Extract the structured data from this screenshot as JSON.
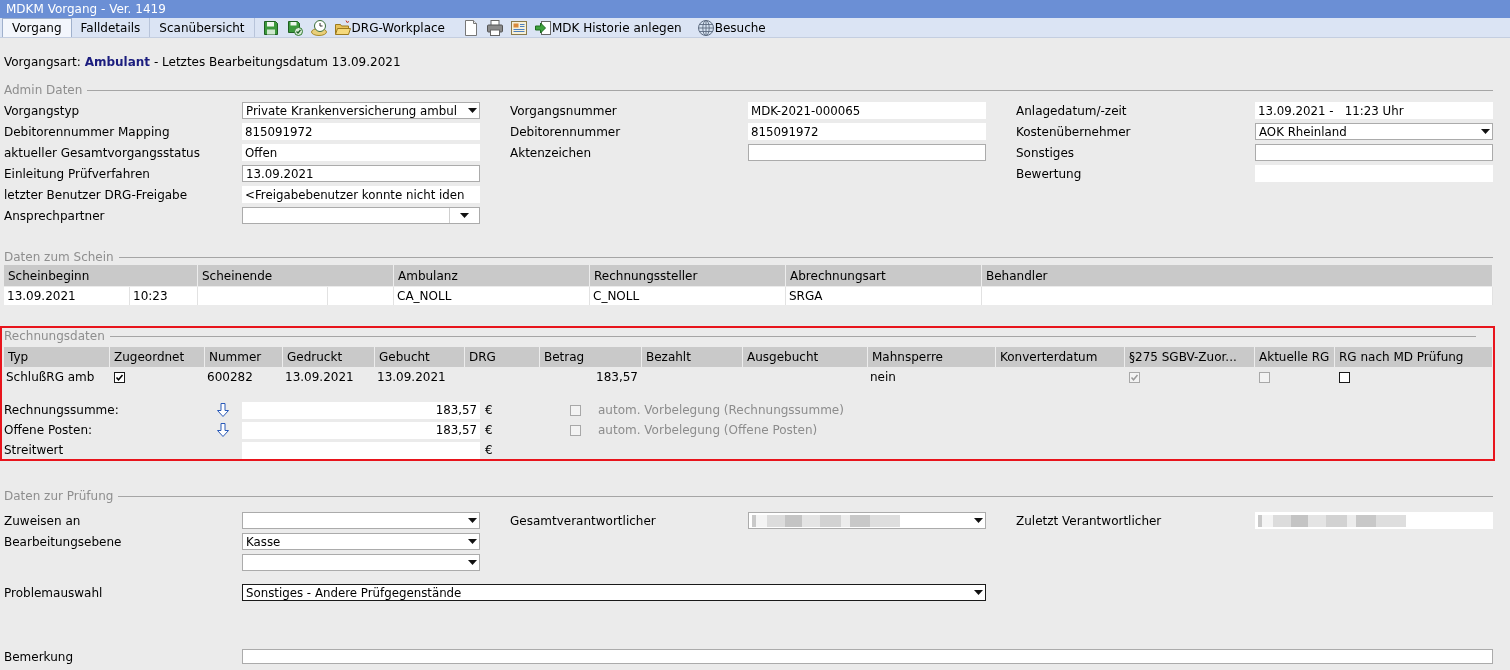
{
  "window": {
    "title": "MDKM Vorgang - Ver. 1419"
  },
  "tabs": [
    {
      "label": "Vorgang",
      "selected": true
    },
    {
      "label": "Falldetails",
      "selected": false
    },
    {
      "label": "Scanübersicht",
      "selected": false
    }
  ],
  "toolbar": [
    "DRG-Workplace",
    "MDK Historie anlegen",
    "Besuche"
  ],
  "case_type": {
    "label": "Vorgangsart:",
    "value": "Ambulant",
    "suffix": "- Letztes Bearbeitungsdatum 13.09.2021"
  },
  "admin": {
    "title": "Admin Daten",
    "columns": [
      [
        {
          "label": "Vorgangstyp",
          "kind": "dropdown",
          "value": "Private Krankenversicherung ambul"
        },
        {
          "label": "Debitorennummer Mapping",
          "kind": "text",
          "value": "815091972"
        },
        {
          "label": "aktueller Gesamtvorgangsstatus",
          "kind": "text",
          "value": "Offen"
        },
        {
          "label": "Einleitung Prüfverfahren",
          "kind": "input",
          "value": "13.09.2021"
        },
        {
          "label": "letzter Benutzer DRG-Freigabe",
          "kind": "text",
          "value": "<Freigabebenutzer konnte nicht iden"
        },
        {
          "label": "Ansprechpartner",
          "kind": "combo"
        }
      ],
      [
        {
          "label": "Vorgangsnummer",
          "kind": "text",
          "value": "MDK-2021-000065"
        },
        {
          "label": "Debitorennummer",
          "kind": "text",
          "value": "815091972"
        },
        {
          "label": "Aktenzeichen",
          "kind": "input"
        }
      ],
      [
        {
          "label": "Anlagedatum/-zeit",
          "kind": "text",
          "value": "13.09.2021 -   11:23 Uhr"
        },
        {
          "label": "Kostenübernehmer",
          "kind": "dropdown",
          "value": "AOK Rheinland"
        },
        {
          "label": "Sonstiges",
          "kind": "input"
        },
        {
          "label": "Bewertung",
          "kind": "text"
        }
      ]
    ]
  },
  "schein": {
    "title": "Daten zum Schein",
    "columns": [
      "Scheinbeginn",
      "Scheinende",
      "Ambulanz",
      "Rechnungssteller",
      "Abrechnungsart",
      "Behandler"
    ],
    "row": {
      "begin_date": "13.09.2021",
      "begin_time": "10:23",
      "ambulanz": "CA_NOLL",
      "rechnungssteller": "C_NOLL",
      "abrechnungsart": "SRGA"
    }
  },
  "rechnung": {
    "title": "Rechnungsdaten",
    "highlighted": true,
    "columns": [
      "Typ",
      "Zugeordnet",
      "Nummer",
      "Gedruckt",
      "Gebucht",
      "DRG",
      "Betrag",
      "Bezahlt",
      "Ausgebucht",
      "Mahnsperre",
      "Konverterdatum",
      "§275 SGBV-Zuor...",
      "Aktuelle RG",
      "RG nach MD Prüfung"
    ],
    "row": {
      "typ": "SchlußRG amb",
      "zugeordnet": {
        "checked": true,
        "disabled": false
      },
      "nummer": "600282",
      "gedruckt": "13.09.2021",
      "gebucht": "13.09.2021",
      "betrag": "183,57",
      "mahnsperre": "nein",
      "zuordnung_275": {
        "checked": true,
        "disabled": true
      },
      "aktuelle_rg": {
        "checked": false,
        "disabled": true
      },
      "rg_nach_md": {
        "checked": false,
        "disabled": false
      }
    },
    "amounts": [
      {
        "label": "Rechnungssumme:",
        "transfer": true,
        "value": "183,57",
        "currency": "€",
        "auto": {
          "label": "autom. Vorbelegung (Rechnungssumme)",
          "checked": false,
          "disabled": true
        }
      },
      {
        "label": "Offene Posten:",
        "transfer": true,
        "value": "183,57",
        "currency": "€",
        "auto": {
          "label": "autom. Vorbelegung (Offene Posten)",
          "checked": false,
          "disabled": true
        }
      },
      {
        "label": "Streitwert",
        "transfer": false,
        "currency": "€"
      }
    ]
  },
  "pruefung": {
    "title": "Daten zur Prüfung",
    "columns": [
      [
        {
          "label": "Zuweisen an",
          "kind": "dropdown",
          "redacted": false
        },
        {
          "label": "Bearbeitungsebene",
          "kind": "dropdown",
          "value": "Kasse",
          "redacted": false
        },
        {
          "kind": "dropdown",
          "redacted": false
        }
      ],
      [
        {
          "label": "Gesamtverantwortlicher",
          "kind": "dropdown",
          "redacted": true
        }
      ],
      [
        {
          "label": "Zuletzt Verantwortlicher",
          "kind": "text",
          "redacted": true
        }
      ]
    ],
    "problem": {
      "label": "Problemauswahl",
      "value": "Sonstiges - Andere Prüfgegenstände",
      "focused": true
    },
    "remark": {
      "label": "Bemerkung"
    }
  }
}
